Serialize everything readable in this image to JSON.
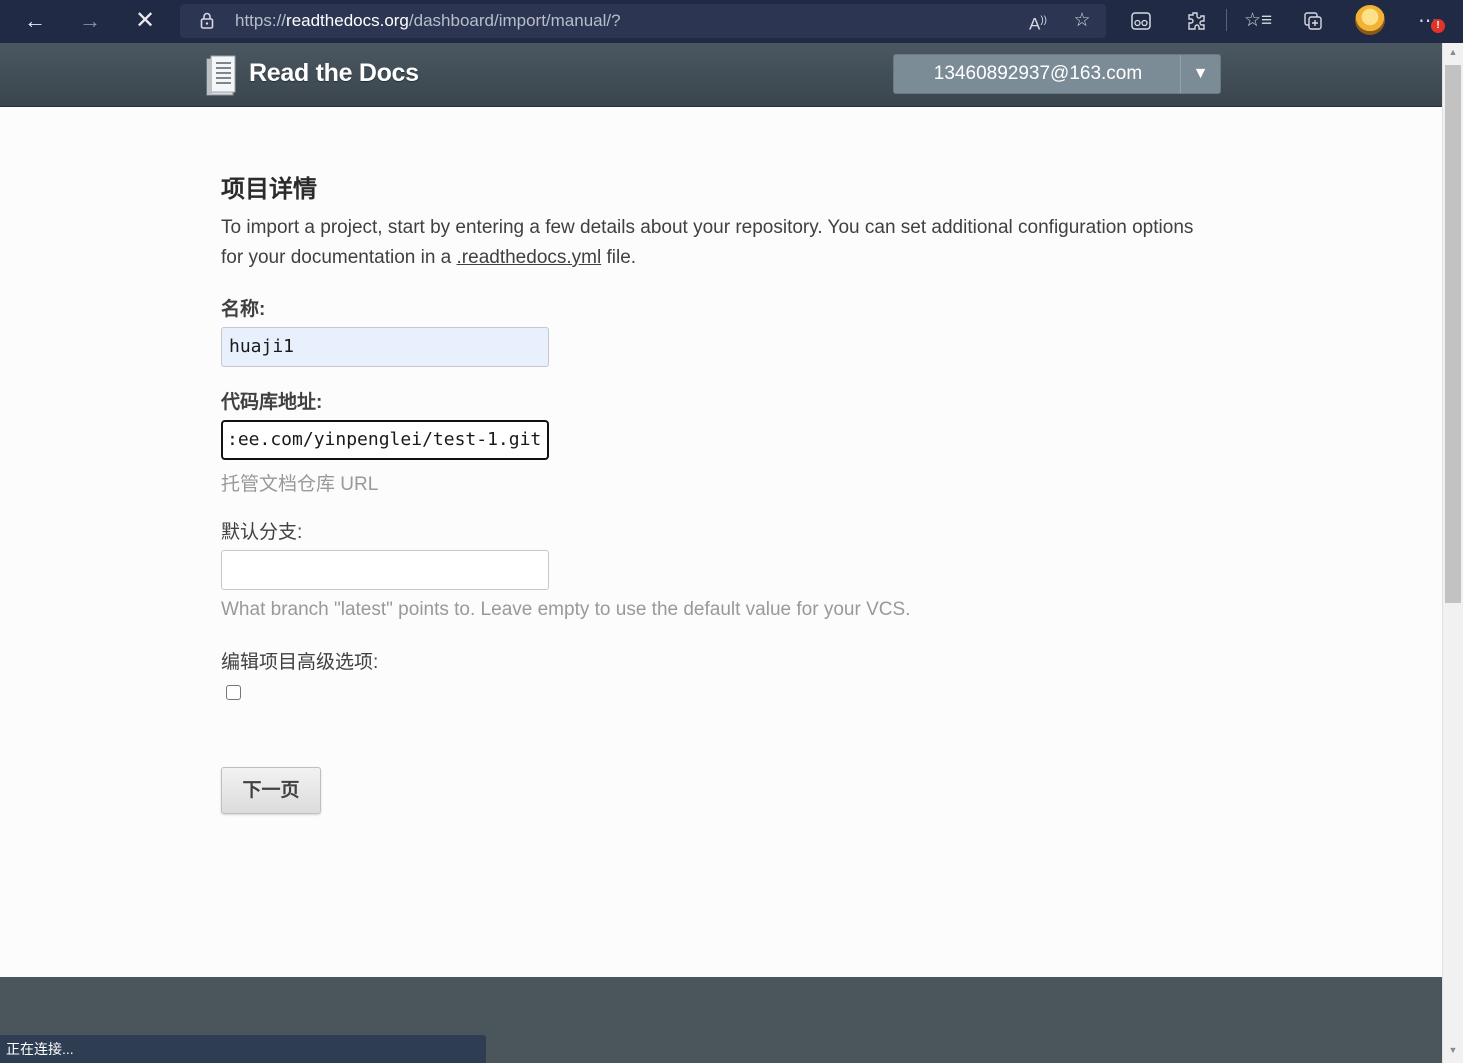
{
  "browser": {
    "url_prefix": "https://",
    "url_domain": "readthedocs.org",
    "url_path": "/dashboard/import/manual/?",
    "icons": [
      "back-icon",
      "forward-icon",
      "stop-icon",
      "lock-icon",
      "read-aloud-icon",
      "add-favorite-icon",
      "reader-mode-icon",
      "extensions-icon",
      "favorites-icon",
      "collections-icon",
      "profile-avatar",
      "more-icon"
    ],
    "read_aloud_glyph": "A⁰",
    "more_badge": "!"
  },
  "header": {
    "logo_text": "Read the Docs",
    "user_email": "13460892937@163.com",
    "caret": "▼"
  },
  "page": {
    "title": "项目详情",
    "intro_before_link": "To import a project, start by entering a few details about your repository. You can set additional configuration options for your documentation in a ",
    "intro_link": ".readthedocs.yml",
    "intro_after_link": " file."
  },
  "form": {
    "name_label": "名称:",
    "name_value": "huaji1",
    "repo_label": "代码库地址:",
    "repo_value": ":ee.com/yinpenglei/test-1.git",
    "repo_help": "托管文档仓库 URL",
    "branch_label": "默认分支:",
    "branch_value": "",
    "branch_help": "What branch \"latest\" points to. Leave empty to use the default value for your VCS.",
    "advanced_label": "编辑项目高级选项:",
    "advanced_checked": false,
    "next_button": "下一页"
  },
  "status_bar": {
    "text": "正在连接..."
  },
  "colors": {
    "browser_bar": "#202a44",
    "header": "#4b5861",
    "user_menu": "#7c8c97",
    "autofill": "#e8f0fe",
    "footer": "#4a555c",
    "help_text": "#999999"
  }
}
